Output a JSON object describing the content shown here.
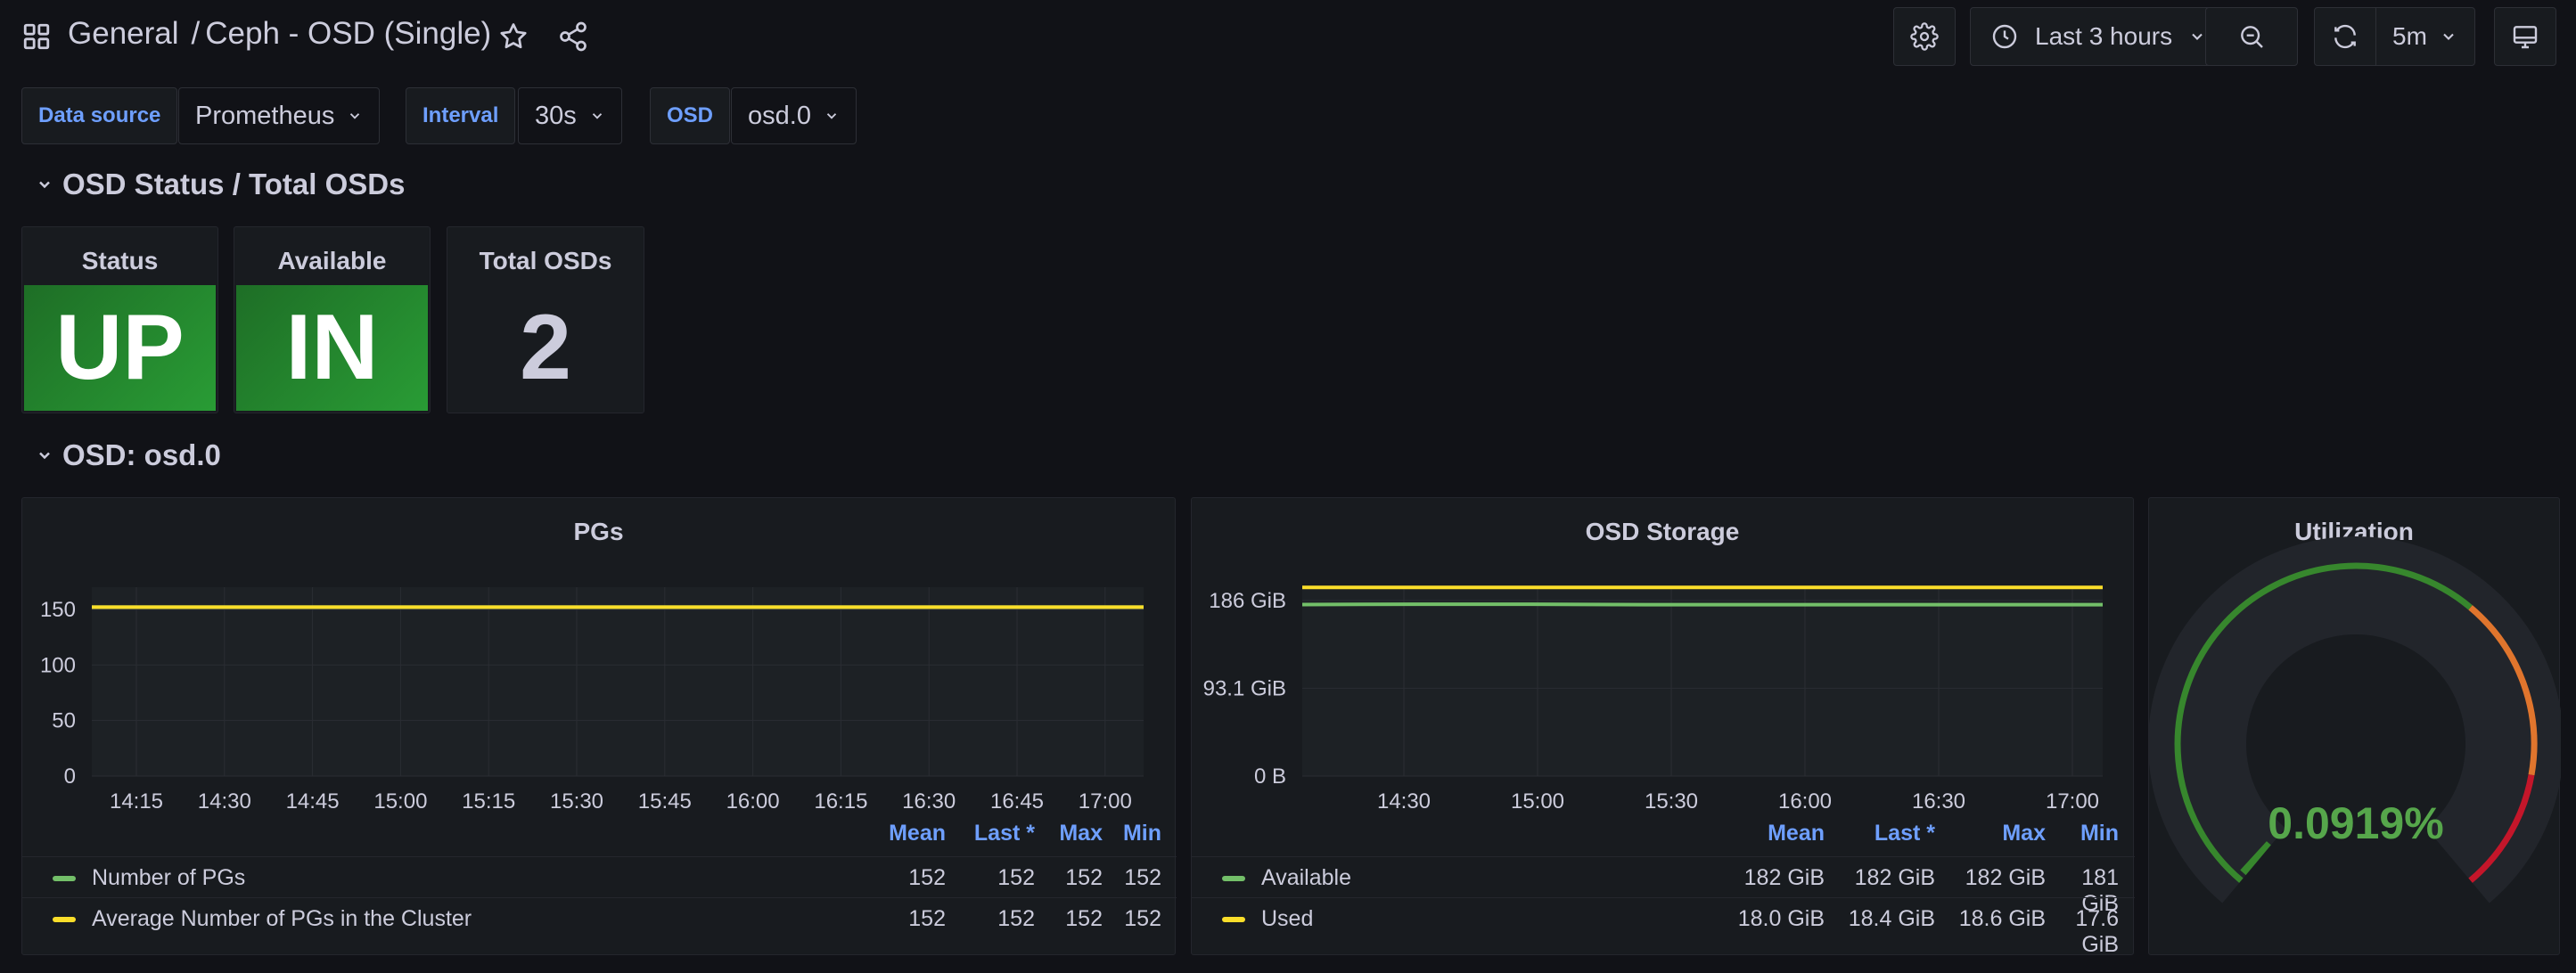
{
  "header": {
    "breadcrumb_folder": "General",
    "breadcrumb_sep": "/",
    "dashboard_title": "Ceph - OSD (Single)",
    "time_range": "Last 3 hours",
    "refresh_interval": "5m"
  },
  "variables": [
    {
      "label": "Data source",
      "value": "Prometheus"
    },
    {
      "label": "Interval",
      "value": "30s"
    },
    {
      "label": "OSD",
      "value": "osd.0"
    }
  ],
  "rows": {
    "status_row": "OSD Status / Total OSDs",
    "osd_row": "OSD: osd.0"
  },
  "stats": [
    {
      "title": "Status",
      "value": "UP"
    },
    {
      "title": "Available",
      "value": "IN"
    },
    {
      "title": "Total OSDs",
      "value": "2"
    }
  ],
  "colors": {
    "green": "#73bf69",
    "yellow": "#fade2a",
    "gauge_green": "#37872d",
    "gauge_orange": "#e0752d",
    "gauge_red": "#c4162a",
    "accent_blue": "#6e9fff"
  },
  "chart_data": [
    {
      "type": "line",
      "title": "PGs",
      "x": [
        "14:15",
        "14:30",
        "14:45",
        "15:00",
        "15:15",
        "15:30",
        "15:45",
        "16:00",
        "16:15",
        "16:30",
        "16:45",
        "17:00"
      ],
      "yticks": [
        "0",
        "50",
        "100",
        "150"
      ],
      "ylim": [
        0,
        170
      ],
      "series": [
        {
          "name": "Number of PGs",
          "color": "#73bf69",
          "values": [
            152,
            152,
            152,
            152,
            152,
            152,
            152,
            152,
            152,
            152,
            152,
            152
          ]
        },
        {
          "name": "Average Number of PGs in the Cluster",
          "color": "#fade2a",
          "values": [
            152,
            152,
            152,
            152,
            152,
            152,
            152,
            152,
            152,
            152,
            152,
            152
          ]
        }
      ],
      "legend": {
        "columns": [
          "Mean",
          "Last *",
          "Max",
          "Min"
        ],
        "rows": [
          {
            "name": "Number of PGs",
            "values": [
              "152",
              "152",
              "152",
              "152"
            ]
          },
          {
            "name": "Average Number of PGs in the Cluster",
            "values": [
              "152",
              "152",
              "152",
              "152"
            ]
          }
        ]
      }
    },
    {
      "type": "line",
      "title": "OSD Storage",
      "x": [
        "14:30",
        "15:00",
        "15:30",
        "16:00",
        "16:30",
        "17:00"
      ],
      "yticks": [
        "0 B",
        "93.1 GiB",
        "186 GiB"
      ],
      "ylim": [
        0,
        200
      ],
      "series": [
        {
          "name": "Available",
          "color": "#73bf69",
          "values": [
            181.6,
            182,
            182,
            181.5,
            181.5,
            181.5,
            181.5,
            181.5
          ]
        },
        {
          "name": "Used",
          "color": "#fade2a",
          "values": [
            199.8,
            199.8,
            199.8,
            199.8,
            199.8,
            199.8,
            199.8,
            199.8
          ]
        }
      ],
      "legend": {
        "columns": [
          "Mean",
          "Last *",
          "Max",
          "Min"
        ],
        "rows": [
          {
            "name": "Available",
            "values": [
              "182 GiB",
              "182 GiB",
              "182 GiB",
              "181 GiB"
            ]
          },
          {
            "name": "Used",
            "values": [
              "18.0 GiB",
              "18.4 GiB",
              "18.6 GiB",
              "17.6 GiB"
            ]
          }
        ]
      }
    }
  ],
  "gauge": {
    "title": "Utilization",
    "value_text": "0.0919%",
    "value_fraction": 0.000919
  }
}
